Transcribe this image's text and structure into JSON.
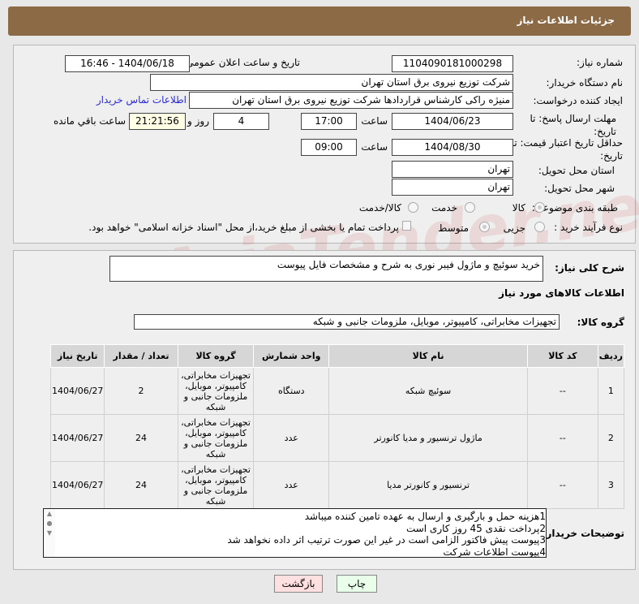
{
  "header": {
    "title": "جزئیات اطلاعات نیاز"
  },
  "form": {
    "need_number_label": "شماره نیاز:",
    "need_number": "1104090181000298",
    "announce_label": "تاریخ و ساعت اعلان عمومی:",
    "announce_value": "1404/06/18 - 16:46",
    "buyer_org_label": "نام دستگاه خریدار:",
    "buyer_org": "شرکت توزیع نیروی برق استان تهران",
    "creator_label": "ایجاد کننده درخواست:",
    "creator": "منیژه راکی کارشناس قراردادها شرکت توزیع نیروی برق استان تهران",
    "contact_link": "اطلاعات تماس خریدار",
    "deadline_label": "مهلت ارسال پاسخ: تا تاریخ:",
    "deadline_date": "1404/06/23",
    "time_label": "ساعت",
    "deadline_time": "17:00",
    "days": "4",
    "days_label": "روز و",
    "remaining": "21:21:56",
    "remaining_label": "ساعت باقي مانده",
    "validity_label": "حداقل تاریخ اعتبار قیمت: تا تاریخ:",
    "validity_date": "1404/08/30",
    "validity_time": "09:00",
    "province_label": "استان محل تحویل:",
    "province": "تهران",
    "city_label": "شهر محل تحویل:",
    "city": "تهران",
    "category_label": "طبقه بندی موضوعی:",
    "category_options": [
      "کالا",
      "خدمت",
      "کالا/خدمت"
    ],
    "process_label": "نوع فرآیند خرید :",
    "process_options": [
      "جزیی",
      "متوسط"
    ],
    "payment_note": "پرداخت تمام یا بخشی از مبلغ خرید،از محل \"اسناد خزانه اسلامی\" خواهد بود."
  },
  "description": {
    "label": "شرح کلی نیاز:",
    "value": "خرید سوئیچ و ماژول فیبر نوری به شرح و مشخصات فایل پیوست"
  },
  "goods": {
    "title": "اطلاعات کالاهای مورد نیاز",
    "group_label": "گروه کالا:",
    "group_value": "تجهیزات مخابراتی، کامپیوتر، موبایل، ملزومات جانبی و شبکه",
    "columns": [
      "ردیف",
      "کد کالا",
      "نام کالا",
      "واحد شمارش",
      "گروه کالا",
      "تعداد / مقدار",
      "تاریخ نیاز"
    ],
    "rows": [
      [
        "1",
        "--",
        "سوئیچ شبکه",
        "دستگاه",
        "تجهیزات مخابراتی، کامپیوتر، موبایل، ملزومات جانبی و شبکه",
        "2",
        "1404/06/27"
      ],
      [
        "2",
        "--",
        "ماژول ترنسیور و مدیا کانورتر",
        "عدد",
        "تجهیزات مخابراتی، کامپیوتر، موبایل، ملزومات جانبی و شبکه",
        "24",
        "1404/06/27"
      ],
      [
        "3",
        "--",
        "ترنسیور و کانورتر مدیا",
        "عدد",
        "تجهیزات مخابراتی، کامپیوتر، موبایل، ملزومات جانبی و شبکه",
        "24",
        "1404/06/27"
      ]
    ]
  },
  "notes": {
    "label": "توضیحات خریدار:",
    "lines": [
      "1هزینه حمل و بارگیری و ارسال به عهده تامین کننده میباشد",
      "2پرداخت نقدی 45 روز کاری است",
      "3پیوست پیش فاکتور الزامی است در غیر این صورت ترتیب اثر داده نخواهد شد",
      "4پیوست اطلاعات شرکت"
    ]
  },
  "buttons": {
    "print": "چاپ",
    "back": "بازگشت"
  },
  "watermark": "AriaTender.net"
}
